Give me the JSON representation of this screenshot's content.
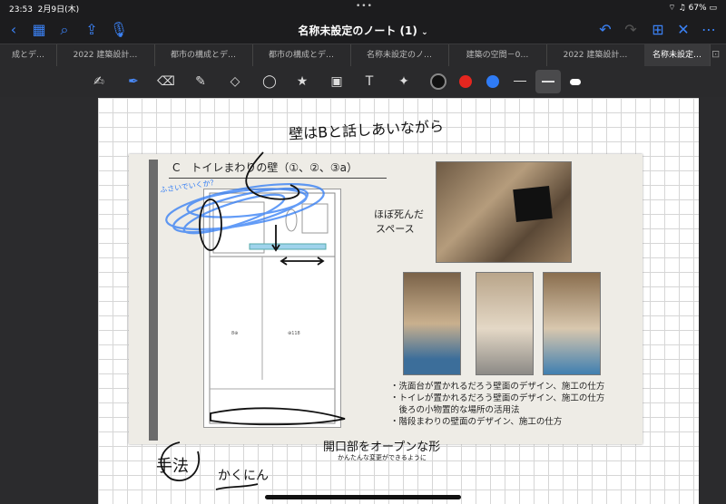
{
  "status": {
    "time": "23:53",
    "date": "2月9日(木)",
    "battery": "67%"
  },
  "nav": {
    "title": "名称未設定のノート (1)"
  },
  "tabs": [
    {
      "label": "成とデ…"
    },
    {
      "label": "2022 建築設計…"
    },
    {
      "label": "都市の構成とデ…"
    },
    {
      "label": "都市の構成とデ…"
    },
    {
      "label": "名称未設定のノ…"
    },
    {
      "label": "建築の空間－0…"
    },
    {
      "label": "2022 建築設計…"
    },
    {
      "label": "名称未設定…"
    }
  ],
  "colors": {
    "black": "#111111",
    "red": "#e5261f",
    "blue": "#2f7bf5",
    "white": "#ffffff",
    "accent": "#3b82f6"
  },
  "slide": {
    "heading": "C　トイレまわりの壁（①、②、③a）",
    "photo_caption_1": "ほぼ死んだ",
    "photo_caption_2": "スペース",
    "bullets": [
      "・洗面台が置かれるだろう壁面のデザイン、施工の仕方",
      "・トイレが置かれるだろう壁面のデザイン、施工の仕方",
      "　後ろの小物置的な場所の活用法",
      "・階段まわりの壁面のデザイン、施工の仕方"
    ],
    "plan_label_left": "8⊕",
    "plan_label_right": "⊕118"
  },
  "annotations": {
    "top_note": "壁はBと話しあいながら",
    "blue_scribble": "ふさいでいくか？",
    "bottom_note": "開口部をオープンな形",
    "bottom_note_sub": "かんたんな変更ができるように",
    "method": "手法",
    "confirm": "かくにん"
  }
}
